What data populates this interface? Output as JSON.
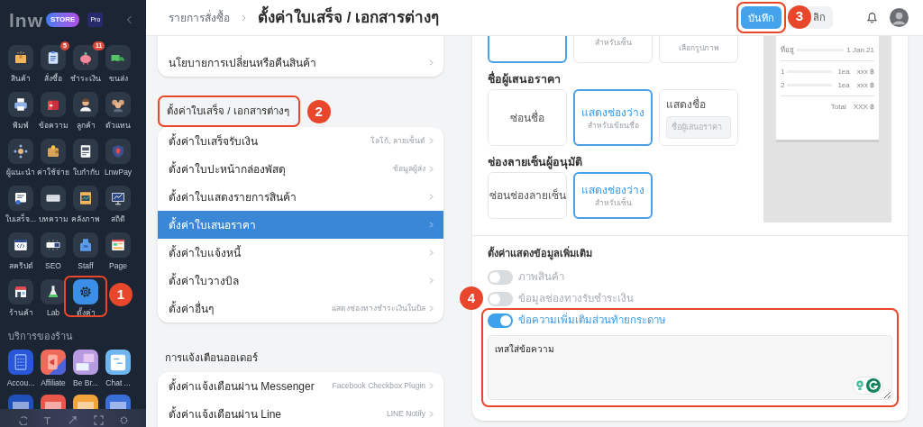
{
  "sidebar": {
    "logo": {
      "wordmark": "lnw",
      "badge": "STORE",
      "tier": "Pro"
    },
    "tiles": [
      {
        "label": "สินค้า",
        "selected": false
      },
      {
        "label": "สั่งซื้อ",
        "count": "5",
        "selected": false
      },
      {
        "label": "ชำระเงิน",
        "count": "11",
        "selected": false
      },
      {
        "label": "ขนส่ง",
        "selected": false
      },
      {
        "label": "พิมพ์",
        "selected": false
      },
      {
        "label": "ข้อความ",
        "selected": false
      },
      {
        "label": "ลูกค้า",
        "selected": false
      },
      {
        "label": "ตัวแทน",
        "selected": false
      },
      {
        "label": "ผู้แนะนำ",
        "selected": false
      },
      {
        "label": "ค่าใช้จ่าย",
        "selected": false
      },
      {
        "label": "ใบกำกับ",
        "selected": false
      },
      {
        "label": "LnwPay",
        "selected": false
      },
      {
        "label": "ใบเสร็จ...",
        "selected": false
      },
      {
        "label": "บทความ",
        "selected": false
      },
      {
        "label": "คลังภาพ",
        "selected": false
      },
      {
        "label": "สถิติ",
        "selected": false
      },
      {
        "label": "สคริปต์",
        "selected": false
      },
      {
        "label": "SEO",
        "selected": false
      },
      {
        "label": "Staff",
        "selected": false
      },
      {
        "label": "Page",
        "selected": false
      },
      {
        "label": "ร้านค้า",
        "selected": false
      },
      {
        "label": "Lab",
        "selected": false
      },
      {
        "label": "ตั้งค่า",
        "selected": true,
        "annotation": "1"
      }
    ],
    "services_title": "บริการของร้าน",
    "services": [
      {
        "label": "Accou..."
      },
      {
        "label": "Affiliate"
      },
      {
        "label": "Be Br..."
      },
      {
        "label": "Chat ..."
      }
    ]
  },
  "header": {
    "breadcrumb": "รายการสั่งซื้อ",
    "title": "ตั้งค่าใบเสร็จ / เอกสารต่างๆ",
    "save": {
      "label": "บันทึก",
      "annotation": "3"
    },
    "cancel": {
      "label": "ลิก"
    }
  },
  "menu": [
    {
      "items": [
        {
          "label": "นโยบายการเปลี่ยนหรือคืนสินค้า",
          "selected": false
        }
      ]
    },
    {
      "title": "ตั้งค่าใบเสร็จ / เอกสารต่างๆ",
      "annotation": "2",
      "items": [
        {
          "label": "ตั้งค่าใบเสร็จรับเงิน",
          "hint": "โลโก้, ลายเซ็นต์",
          "selected": false
        },
        {
          "label": "ตั้งค่าใบปะหน้ากล่องพัสดุ",
          "hint": "ข้อมูลผู้ส่ง",
          "selected": false
        },
        {
          "label": "ตั้งค่าใบแสดงรายการสินค้า",
          "selected": false
        },
        {
          "label": "ตั้งค่าใบเสนอราคา",
          "selected": true
        },
        {
          "label": "ตั้งค่าใบแจ้งหนี้",
          "selected": false
        },
        {
          "label": "ตั้งค่าใบวางบิล",
          "selected": false
        },
        {
          "label": "ตั้งค่าอื่นๆ",
          "hint": "แสดงช่องทางชำระเงินในบิล",
          "selected": false
        }
      ]
    },
    {
      "title": "การแจ้งเตือนออเดอร์",
      "items": [
        {
          "label": "ตั้งค่าแจ้งเตือนผ่าน Messenger",
          "hint": "Facebook Checkbox Plugin",
          "selected": false
        },
        {
          "label": "ตั้งค่าแจ้งเตือนผ่าน Line",
          "hint": "LINE Notify",
          "selected": false
        }
      ]
    }
  ],
  "form": {
    "groups": [
      {
        "options": [
          {
            "selected": true
          },
          {
            "subtitle": "สำหรับเซ็น",
            "selected": false
          },
          {
            "subtitle": "เลือกรูปภาพ",
            "selected": false
          }
        ]
      },
      {
        "title": "ชื่อผู้เสนอราคา",
        "options": [
          {
            "title": "ซ่อนชื่อ",
            "selected": false
          },
          {
            "title": "แสดงช่องว่าง",
            "subtitle": "สำหรับเขียนชื่อ",
            "selected": true
          },
          {
            "title": "แสดงชื่อ",
            "placeholder": "ชื่อผู้เสนอราคา",
            "selected": false
          }
        ]
      },
      {
        "title": "ช่องลายเซ็นผู้อนุมัติ",
        "options": [
          {
            "title": "ซ่อนช่องลายเซ็น",
            "selected": false
          },
          {
            "title": "แสดงช่องว่าง",
            "subtitle": "สำหรับเซ็น",
            "selected": true
          }
        ]
      }
    ]
  },
  "preview": {
    "rows": [
      {
        "kind": "field",
        "label": "ที่อยู่",
        "value": "1 Jan 21"
      },
      {
        "kind": "rule"
      },
      {
        "kind": "item",
        "no": "1",
        "qty": "1ea",
        "amount": "xxx ฿"
      },
      {
        "kind": "item",
        "no": "2",
        "qty": "1ea",
        "amount": "xxx ฿"
      },
      {
        "kind": "rule"
      },
      {
        "kind": "total",
        "label": "Total",
        "value": "XXX ฿"
      }
    ]
  },
  "extras": {
    "title": "ตั้งค่าแสดงข้อมูลเพิ่มเติม",
    "annotation": "4",
    "toggles": [
      {
        "label": "ภาพสินค้า",
        "on": false
      },
      {
        "label": "ข้อมูลช่องทางรับชำระเงิน",
        "on": false
      },
      {
        "label": "ข้อความเพิ่มเติมส่วนท้ายกระดาษ",
        "on": true
      }
    ],
    "note": {
      "value": "เทสใส่ข้อความ"
    }
  }
}
